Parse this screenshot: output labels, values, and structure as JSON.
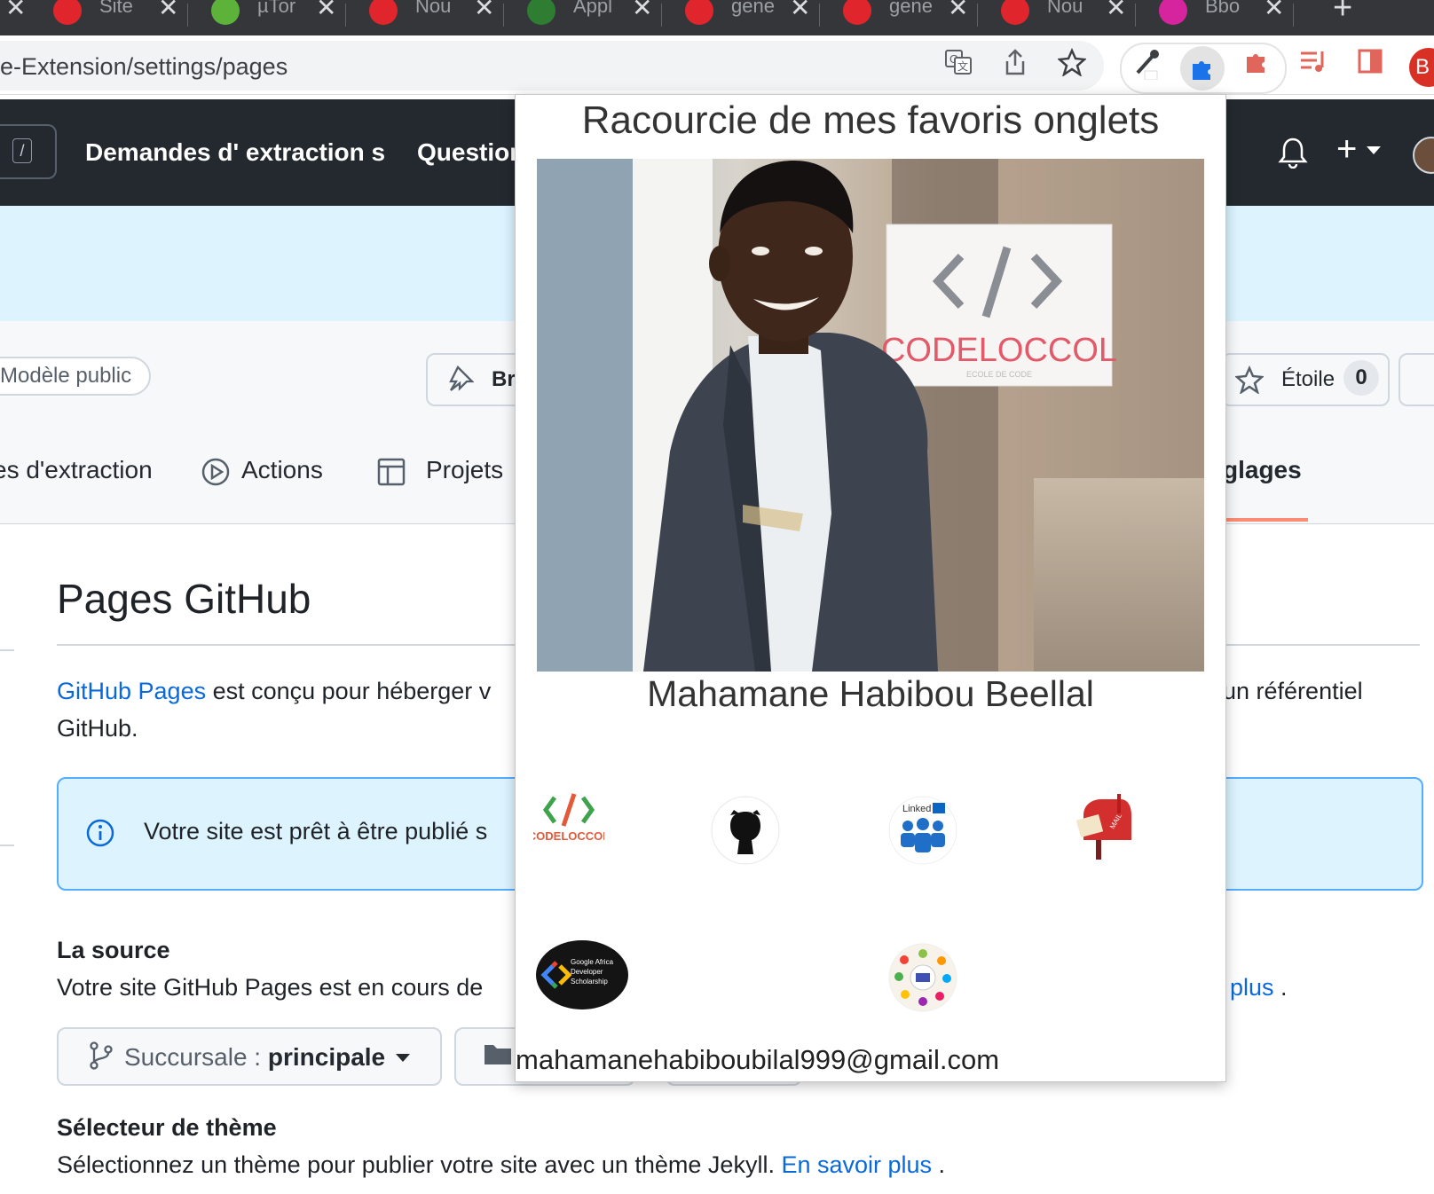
{
  "browser": {
    "tabs": [
      {
        "title": "Site",
        "icon": "opera-icon",
        "color": "#e0262c"
      },
      {
        "title": "µTor",
        "icon": "utorrent-icon",
        "color": "#5db33a"
      },
      {
        "title": "Nou",
        "icon": "opera-icon",
        "color": "#e0262c"
      },
      {
        "title": "Appl",
        "icon": "codeloccol-icon",
        "color": "#2e7d32"
      },
      {
        "title": "gene",
        "icon": "opera-icon",
        "color": "#e0262c"
      },
      {
        "title": "gene",
        "icon": "opera-icon",
        "color": "#e0262c"
      },
      {
        "title": "Nou",
        "icon": "opera-icon",
        "color": "#e0262c"
      },
      {
        "title": "Bbo",
        "icon": "instagram-icon",
        "color": "#d6249f"
      }
    ],
    "address": "e-Extension/settings/pages",
    "new_tab": "+",
    "close": "✕",
    "profile_initial": "B"
  },
  "github": {
    "slash_key": "/",
    "nav": [
      "Demandes d' extraction s",
      "Questions"
    ],
    "plus": "+",
    "visibility_badge": "Modèle public",
    "pin_label": "Br",
    "star_label": "Étoile",
    "star_count": "0",
    "tabs": [
      "es d'extraction",
      "Actions",
      "Projets",
      "glages"
    ],
    "page_title": "Pages GitHub",
    "intro_link": "GitHub Pages",
    "intro_text": " est conçu pour héberger v",
    "intro_tail": "un référentiel",
    "intro_line2": "GitHub.",
    "flash_text": "Votre site est prêt à être publié s",
    "source_heading": "La source",
    "source_text": "Votre site GitHub Pages est en cours de",
    "source_link_tail": "plus",
    "source_period": ".",
    "branch_prefix": "Succursale : ",
    "branch_name": "principale",
    "theme_heading": "Sélecteur de thème",
    "theme_text": "Sélectionnez un thème pour publier votre site avec un thème Jekyll. ",
    "theme_link": "En savoir plus",
    "theme_period": " ."
  },
  "popup": {
    "title": "Racourcie de mes favoris onglets",
    "name": "Mahamane Habibou Beellal",
    "email": "mahamanehabiboubilal999@gmail.com",
    "sign_text": "CODELOCCOL",
    "sign_sub": "ECOLE DE CODE",
    "links_row1": [
      {
        "icon": "codeloccol-icon",
        "label": "CODELOCCOL"
      },
      {
        "icon": "github-icon"
      },
      {
        "icon": "linkedin-icon",
        "label": "Linked"
      },
      {
        "icon": "mailbox-icon",
        "label": "MAIL"
      }
    ],
    "links_row2": [
      {
        "icon": "google-africa-icon",
        "label": "Google Africa Developer Scholarship"
      },
      {
        "icon": "community-icon"
      }
    ]
  }
}
